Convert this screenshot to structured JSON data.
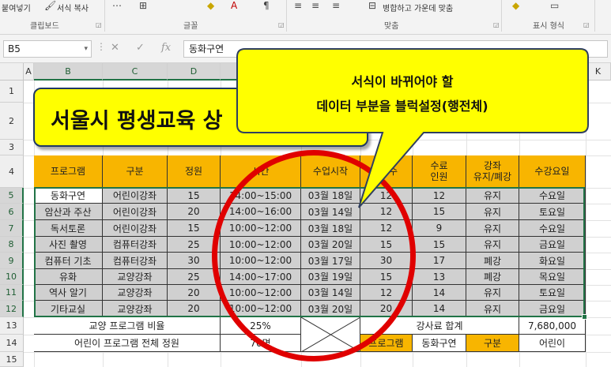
{
  "ribbon": {
    "clipboard_label": "클립보드",
    "font_label": "글꼴",
    "align_label": "맞춤",
    "number_label": "표시 형식",
    "format_painter": "서식 복사",
    "merge_center": "병합하고 가운데 맞춤",
    "paste_partial": "붙여넣기"
  },
  "formula_bar": {
    "name_box": "B5",
    "content": "동화구연",
    "fx": "fx"
  },
  "columns": [
    "A",
    "B",
    "C",
    "D",
    "E",
    "F",
    "G",
    "H",
    "I",
    "J",
    "K"
  ],
  "rows": [
    "1",
    "2",
    "3",
    "4",
    "5",
    "6",
    "7",
    "8",
    "9",
    "10",
    "11",
    "12",
    "13",
    "14",
    "15"
  ],
  "title": "서울시 평생교육 상",
  "callout": {
    "line1": "서식이 바뀌어야 할",
    "line2": "데이터 부분을 블럭설정(행전체)"
  },
  "headers": {
    "program": "프로그램",
    "category": "구분",
    "capacity": "정원",
    "time": "시간",
    "start": "수업시작",
    "count": "수",
    "fee_line1": "수료",
    "fee_line2": "인원",
    "keep_line1": "강좌",
    "keep_line2": "유지/폐강",
    "day": "수강요일"
  },
  "table": [
    {
      "program": "동화구연",
      "category": "어린이강좌",
      "capacity": "15",
      "time": "14:00~15:00",
      "start": "03월 18일",
      "count": "12",
      "completed": "12",
      "status": "유지",
      "day": "수요일"
    },
    {
      "program": "암산과 주산",
      "category": "어린이강좌",
      "capacity": "20",
      "time": "14:00~16:00",
      "start": "03월 14일",
      "count": "12",
      "completed": "15",
      "status": "유지",
      "day": "토요일"
    },
    {
      "program": "독서토론",
      "category": "어린이강좌",
      "capacity": "15",
      "time": "10:00~12:00",
      "start": "03월 18일",
      "count": "12",
      "completed": "9",
      "status": "유지",
      "day": "수요일"
    },
    {
      "program": "사진 촬영",
      "category": "컴퓨터강좌",
      "capacity": "25",
      "time": "10:00~12:00",
      "start": "03월 20일",
      "count": "15",
      "completed": "15",
      "status": "유지",
      "day": "금요일"
    },
    {
      "program": "컴퓨터 기초",
      "category": "컴퓨터강좌",
      "capacity": "30",
      "time": "10:00~12:00",
      "start": "03월 17일",
      "count": "30",
      "completed": "17",
      "status": "폐강",
      "day": "화요일"
    },
    {
      "program": "유화",
      "category": "교양강좌",
      "capacity": "25",
      "time": "14:00~17:00",
      "start": "03월 19일",
      "count": "15",
      "completed": "13",
      "status": "폐강",
      "day": "목요일"
    },
    {
      "program": "역사 알기",
      "category": "교양강좌",
      "capacity": "20",
      "time": "10:00~12:00",
      "start": "03월 14일",
      "count": "12",
      "completed": "14",
      "status": "유지",
      "day": "토요일"
    },
    {
      "program": "기타교실",
      "category": "교양강좌",
      "capacity": "20",
      "time": "10:00~12:00",
      "start": "03월 20일",
      "count": "20",
      "completed": "14",
      "status": "유지",
      "day": "금요일"
    }
  ],
  "summary": {
    "culture_ratio_label": "교양 프로그램 비율",
    "culture_ratio_value": "25%",
    "fee_total_label": "강사료 합계",
    "fee_total_value": "7,680,000",
    "kids_total_label": "어린이 프로그램 전체 정원",
    "kids_total_value": "70명",
    "program_label": "프로그램",
    "program_value": "동화구연",
    "category_label": "구분",
    "category_value": "어린이"
  },
  "colors": {
    "header_orange": "#f8b500",
    "selection_gray": "#d0d0d0",
    "title_yellow": "#ffff00",
    "callout_yellow": "#ffff00",
    "circle_red": "#e00000",
    "excel_green": "#217346"
  }
}
